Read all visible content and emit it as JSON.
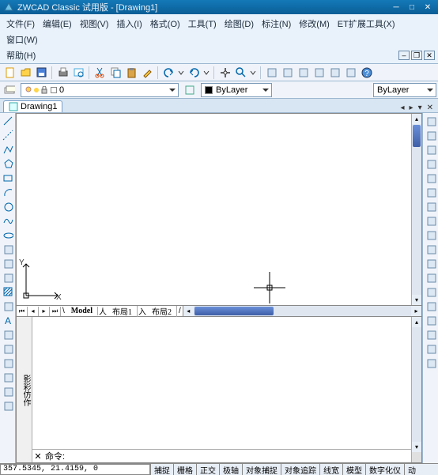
{
  "title": "ZWCAD Classic 试用版 - [Drawing1]",
  "menus": {
    "file": "文件(F)",
    "edit": "编辑(E)",
    "view": "视图(V)",
    "insert": "插入(I)",
    "format": "格式(O)",
    "tools": "工具(T)",
    "draw": "绘图(D)",
    "dimension": "标注(N)",
    "modify": "修改(M)",
    "et": "ET扩展工具(X)",
    "window": "窗口(W)",
    "help": "帮助(H)"
  },
  "document": {
    "tab_name": "Drawing1"
  },
  "layer": {
    "current_display": "0",
    "icons": [
      "lightbulb",
      "sun",
      "lock",
      "color",
      "layer-name"
    ],
    "color_label": "ByLayer",
    "linetype_label": "ByLayer"
  },
  "model_tabs": {
    "model": "Model",
    "layout1": "布局1",
    "layout2": "布局2"
  },
  "axes": {
    "x": "X",
    "y": "Y"
  },
  "command_pane": {
    "side_text": "影彩仿作",
    "prompt": "命令:"
  },
  "status": {
    "coords": "357.5345, 21.4159, 0",
    "toggles": [
      "捕捉",
      "栅格",
      "正交",
      "极轴",
      "对象捕捉",
      "对象追踪",
      "线宽",
      "模型",
      "数字化仪",
      "动"
    ]
  },
  "std_toolbar_icons": [
    "new",
    "open",
    "save",
    "sep",
    "print",
    "preview",
    "sep",
    "cut",
    "copy",
    "paste",
    "matchprop",
    "sep",
    "undo",
    "undo-dd",
    "redo",
    "redo-dd",
    "sep",
    "pan",
    "zoom-rt",
    "zoom-dd",
    "sep",
    "t1",
    "t2",
    "t3",
    "t4",
    "t5",
    "t6",
    "help"
  ],
  "left_tools": [
    "line",
    "xline",
    "polyline",
    "polygon",
    "rectangle",
    "arc",
    "circle",
    "spline",
    "ellipse",
    "ellipse-arc",
    "block",
    "point",
    "hatch",
    "region",
    "text",
    "mline",
    "revcloud",
    "table",
    "t18",
    "t19",
    "t20"
  ],
  "right_tools": [
    "erase",
    "copy",
    "mirror",
    "offset",
    "array",
    "move",
    "rotate",
    "scale",
    "stretch",
    "trim",
    "extend",
    "break",
    "chamfer",
    "fillet",
    "explode",
    "t15",
    "t16",
    "t17"
  ]
}
